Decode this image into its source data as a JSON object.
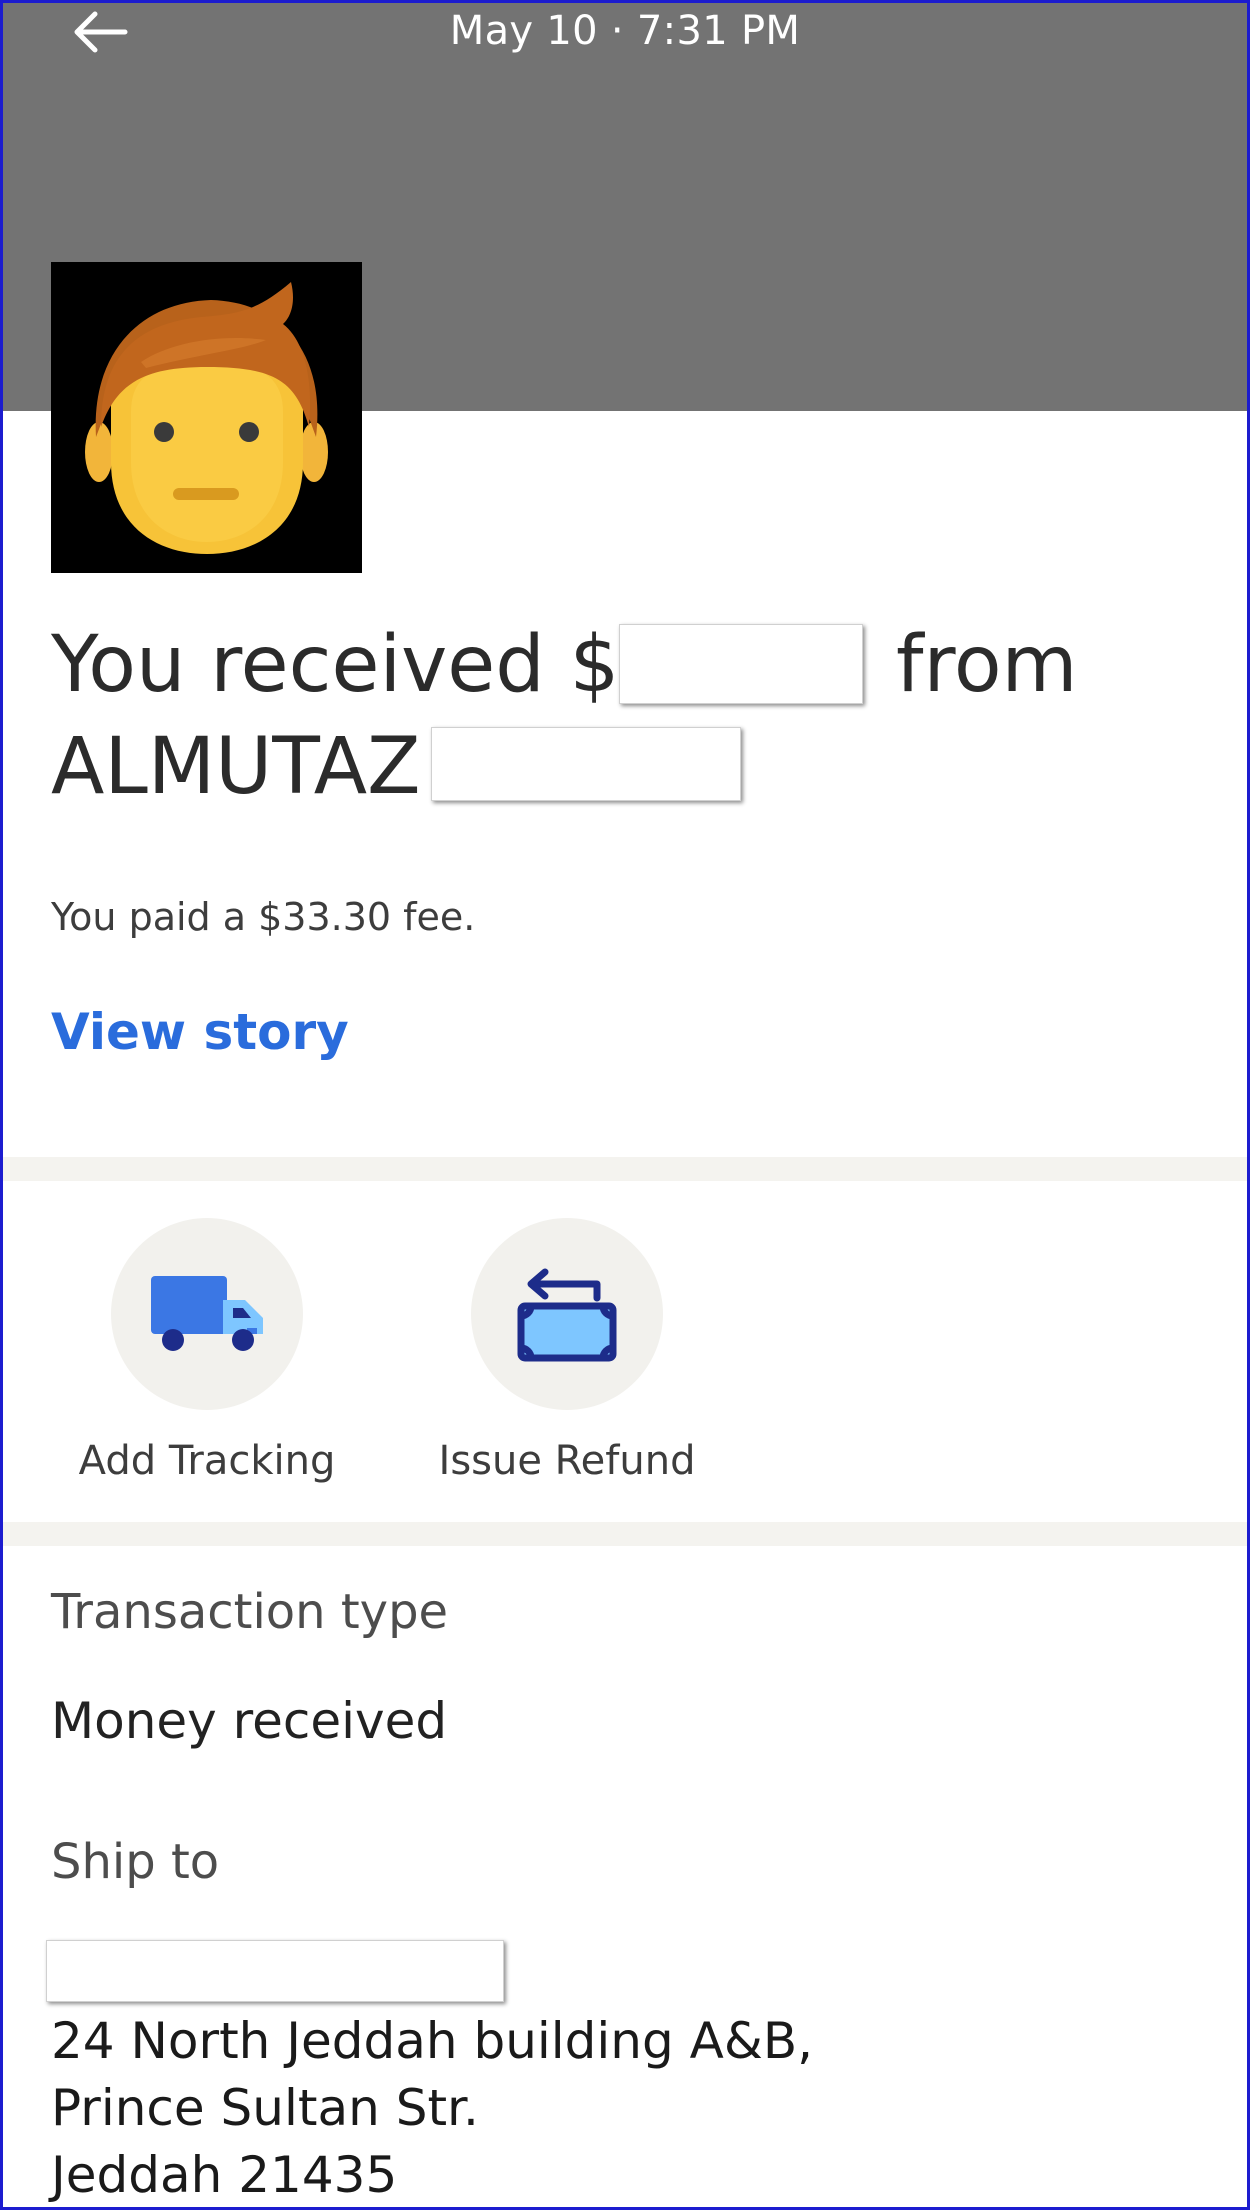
{
  "header": {
    "date_time": "May 10 · 7:31 PM",
    "back_icon": "arrow-left-icon",
    "background_color": "#737373"
  },
  "avatar": {
    "icon": "person-face-avatar"
  },
  "summary": {
    "received_prefix": "You received $",
    "from_word": "from",
    "sender_name": "ALMUTAZ",
    "fee_text": "You paid a $33.30 fee.",
    "view_story_label": "View story",
    "link_color": "#2a6cdc"
  },
  "actions": [
    {
      "label": "Add Tracking",
      "icon": "truck-icon"
    },
    {
      "label": "Issue Refund",
      "icon": "refund-money-icon"
    }
  ],
  "details": {
    "transaction_type_label": "Transaction type",
    "transaction_type_value": "Money received",
    "ship_to_label": "Ship to",
    "address_lines": [
      "24 North Jeddah building A&B,",
      "Prince Sultan Str.",
      "Jeddah 21435"
    ]
  }
}
